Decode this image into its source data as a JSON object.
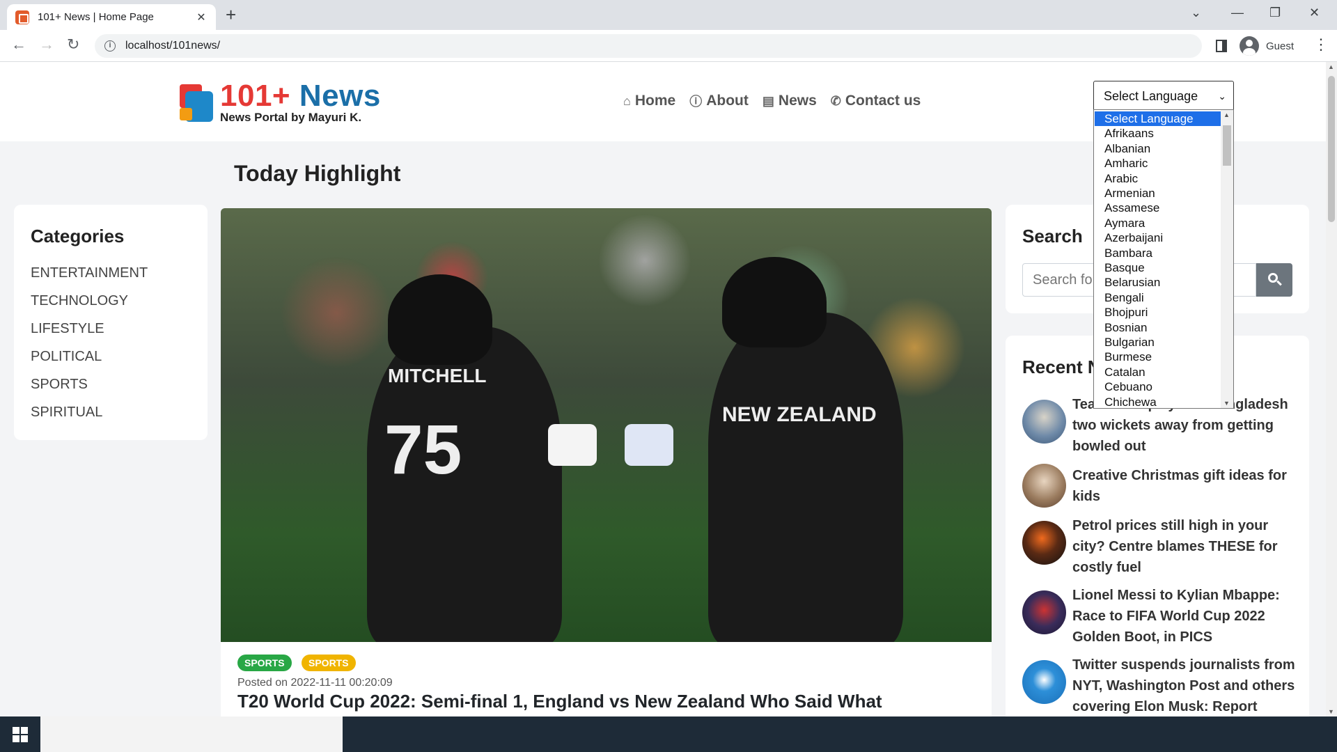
{
  "browser": {
    "tab_title": "101+ News | Home Page",
    "url": "localhost/101news/",
    "profile": "Guest"
  },
  "header": {
    "logo_number": "101+",
    "logo_word": "News",
    "logo_subtitle": "News Portal by Mayuri K.",
    "nav": [
      {
        "label": "Home",
        "icon": "home-icon"
      },
      {
        "label": "About",
        "icon": "info-icon"
      },
      {
        "label": "News",
        "icon": "newspaper-icon"
      },
      {
        "label": "Contact us",
        "icon": "phone-icon"
      }
    ]
  },
  "language": {
    "selected": "Select Language",
    "options": [
      "Select Language",
      "Afrikaans",
      "Albanian",
      "Amharic",
      "Arabic",
      "Armenian",
      "Assamese",
      "Aymara",
      "Azerbaijani",
      "Bambara",
      "Basque",
      "Belarusian",
      "Bengali",
      "Bhojpuri",
      "Bosnian",
      "Bulgarian",
      "Burmese",
      "Catalan",
      "Cebuano",
      "Chichewa"
    ]
  },
  "main": {
    "heading": "Today Highlight",
    "article": {
      "badges": [
        {
          "label": "SPORTS",
          "color": "#28a745"
        },
        {
          "label": "SPORTS",
          "color": "#f0b400"
        }
      ],
      "posted": "Posted on 2022-11-11 00:20:09",
      "title": "T20 World Cup 2022: Semi-final 1, England vs New Zealand Who Said What",
      "image_jersey_name": "MITCHELL",
      "image_jersey_number": "75",
      "image_jersey_team": "NEW ZEALAND"
    }
  },
  "categories": {
    "title": "Categories",
    "items": [
      "ENTERTAINMENT",
      "TECHNOLOGY",
      "LIFESTYLE",
      "POLITICAL",
      "SPORTS",
      "SPIRITUAL"
    ]
  },
  "search": {
    "title": "Search",
    "placeholder": "Search for..."
  },
  "recent": {
    "title": "Recent News",
    "items": [
      "Team India player in Bangladesh two wickets away from getting bowled out",
      "Creative Christmas gift ideas for kids",
      "Petrol prices still high in your city? Centre blames THESE for costly fuel",
      "Lionel Messi to Kylian Mbappe: Race to FIFA World Cup 2022 Golden Boot, in PICS",
      "Twitter suspends journalists from NYT, Washington Post and others covering Elon Musk: Report"
    ]
  },
  "colors": {
    "logo_red": "#e53935",
    "logo_blue": "#1b6fa8",
    "select_highlight": "#1e6fe8",
    "search_button": "#6c757d"
  }
}
